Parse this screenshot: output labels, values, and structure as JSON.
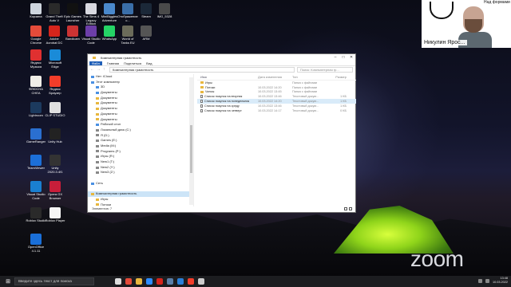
{
  "desktop": {
    "icons": [
      {
        "label": "Корзина",
        "color": "#cfd6df"
      },
      {
        "label": "Grand Theft Auto V",
        "color": "#2a2a2a"
      },
      {
        "label": "Epic Games Launcher",
        "color": "#111111"
      },
      {
        "label": "The Sims 4 Legacy Edition",
        "color": "#d8d8e0"
      },
      {
        "label": "MiniBiggles Adventure",
        "color": "#4a88cc"
      },
      {
        "label": "Отображение с...",
        "color": "#3a6ea8"
      },
      {
        "label": "Steam",
        "color": "#1b2838"
      },
      {
        "label": "IMG_5328",
        "color": "#4a4a4a"
      },
      {
        "label": "Google Chrome",
        "color": "#e44b3a"
      },
      {
        "label": "Adobe Acrobat DC",
        "color": "#d6251c"
      },
      {
        "label": "Bandicam",
        "color": "#cc3333"
      },
      {
        "label": "Visual Studio Code",
        "color": "#6c3ea8"
      },
      {
        "label": "WhatsApp",
        "color": "#25d366"
      },
      {
        "label": "World of Tanks EU",
        "color": "#6b6b5a"
      },
      {
        "label": "ARM",
        "color": "#555555"
      },
      {
        "label": "Яндекс Музыка",
        "color": "#e03030"
      },
      {
        "label": "Microsoft Edge",
        "color": "#1a8bd8"
      },
      {
        "label": "ФЛЮСНА CHEA",
        "color": "#f0eee8"
      },
      {
        "label": "Яндекс Браузер",
        "color": "#f33d2a"
      },
      {
        "label": "Lightroom",
        "color": "#1c3a5e"
      },
      {
        "label": "CLIP STUDIO",
        "color": "#e0e0e0"
      },
      {
        "label": "GameRanger",
        "color": "#2a6fd0"
      },
      {
        "label": "Unity Hub",
        "color": "#222222"
      },
      {
        "label": "TeamViewer",
        "color": "#1c6fd8"
      },
      {
        "label": "Unity 2020.3.4f1",
        "color": "#333333"
      },
      {
        "label": "Visual Studio Code",
        "color": "#1a7fd0"
      },
      {
        "label": "Opera GX Browser",
        "color": "#c81e3a"
      },
      {
        "label": "Roblox Studio",
        "color": "#2a2a2a"
      },
      {
        "label": "Roblox Player",
        "color": "#f5f5f5"
      },
      {
        "label": "OpenOffice 4.1.11",
        "color": "#1a6fd8"
      }
    ]
  },
  "participant": {
    "name": "Никулин Ярос...",
    "text": "Над формами"
  },
  "zoom_logo": "zoom",
  "explorer": {
    "title": "Компьютерная грамотность",
    "ribbon": [
      "Файл",
      "Главная",
      "Поделиться",
      "Вид"
    ],
    "address": "Компьютерная грамотность",
    "search_placeholder": "Поиск: Компьютерная гр...",
    "nav": [
      {
        "label": "Нет: iCloud",
        "color": "#4a90e2",
        "selected": false
      },
      {
        "label": "Этот компьютер",
        "color": "#4a90e2",
        "selected": false
      },
      {
        "label": "3D",
        "color": "#4a90e2",
        "selected": false
      },
      {
        "label": "Документы",
        "color": "#4a90e2",
        "selected": false
      },
      {
        "label": "Документы",
        "color": "#e8b73e",
        "selected": false
      },
      {
        "label": "Документы",
        "color": "#e8b73e",
        "selected": false
      },
      {
        "label": "Документы",
        "color": "#e8b73e",
        "selected": false
      },
      {
        "label": "Документы",
        "color": "#e8b73e",
        "selected": false
      },
      {
        "label": "Документы",
        "color": "#e8b73e",
        "selected": false
      },
      {
        "label": "Рабочий стол",
        "color": "#4a90e2",
        "selected": false
      },
      {
        "label": "Локальный диск (C:)",
        "color": "#888888",
        "selected": false
      },
      {
        "label": "Я (D:)",
        "color": "#888888",
        "selected": false
      },
      {
        "label": "Games (E:)",
        "color": "#888888",
        "selected": false
      },
      {
        "label": "Media (M:)",
        "color": "#888888",
        "selected": false
      },
      {
        "label": "Programs (P:)",
        "color": "#888888",
        "selected": false
      },
      {
        "label": "Игры (R:)",
        "color": "#888888",
        "selected": false
      },
      {
        "label": "New1 (T:)",
        "color": "#888888",
        "selected": false
      },
      {
        "label": "New2 (Y:)",
        "color": "#888888",
        "selected": false
      },
      {
        "label": "New3 (Z:)",
        "color": "#888888",
        "selected": false
      },
      {
        "label": "",
        "color": "#ffffff",
        "selected": false
      },
      {
        "label": "Сеть",
        "color": "#4a90e2",
        "selected": false
      },
      {
        "label": "",
        "color": "#ffffff",
        "selected": false
      },
      {
        "label": "Компьютерная грамотность",
        "color": "#e8b73e",
        "selected": true
      },
      {
        "label": "Игры",
        "color": "#e8b73e",
        "selected": false
      },
      {
        "label": "Потоки",
        "color": "#e8b73e",
        "selected": false
      }
    ],
    "columns": [
      "Имя",
      "Дата изменения",
      "Тип",
      "Размер"
    ],
    "files": [
      {
        "name": "Игры",
        "date": "",
        "type": "Папка с файлами",
        "size": "",
        "kind": "folder",
        "highlight": false
      },
      {
        "name": "Потоки",
        "date": "10.03.2022 14:20",
        "type": "Папка с файлами",
        "size": "",
        "kind": "folder",
        "highlight": false
      },
      {
        "name": "Чипсы",
        "date": "10.03.2022 13:45",
        "type": "Папка с файлами",
        "size": "",
        "kind": "folder",
        "highlight": false
      },
      {
        "name": "Список покупок на вторник",
        "date": "10.03.2022 13:46",
        "type": "Текстовый докум...",
        "size": "1 КБ",
        "kind": "txt",
        "highlight": false
      },
      {
        "name": "Список покупок на понедельник",
        "date": "10.03.2022 14:20",
        "type": "Текстовый докум...",
        "size": "1 КБ",
        "kind": "txt",
        "highlight": true
      },
      {
        "name": "Список покупок на среду",
        "date": "10.03.2022 13:46",
        "type": "Текстовый докум...",
        "size": "1 КБ",
        "kind": "txt",
        "highlight": false
      },
      {
        "name": "Список покупок на четверг",
        "date": "10.03.2022 14:17",
        "type": "Текстовый докум...",
        "size": "0 КБ",
        "kind": "txt",
        "highlight": false
      }
    ],
    "status": "Элементов: 7"
  },
  "taskbar": {
    "search_placeholder": "Введите здесь текст для поиска",
    "apps": [
      {
        "name": "task-view",
        "color": "#dddddd"
      },
      {
        "name": "chrome",
        "color": "#e44b3a"
      },
      {
        "name": "explorer",
        "color": "#e8b73e"
      },
      {
        "name": "zoom",
        "color": "#2d8cff"
      },
      {
        "name": "acrobat",
        "color": "#d6251c"
      },
      {
        "name": "steam",
        "color": "#5a7fa8"
      },
      {
        "name": "mail",
        "color": "#2a7fd8"
      },
      {
        "name": "yandex",
        "color": "#f33d2a"
      },
      {
        "name": "unity",
        "color": "#cccccc"
      }
    ],
    "time": "13:48",
    "date": "10.03.2022"
  }
}
